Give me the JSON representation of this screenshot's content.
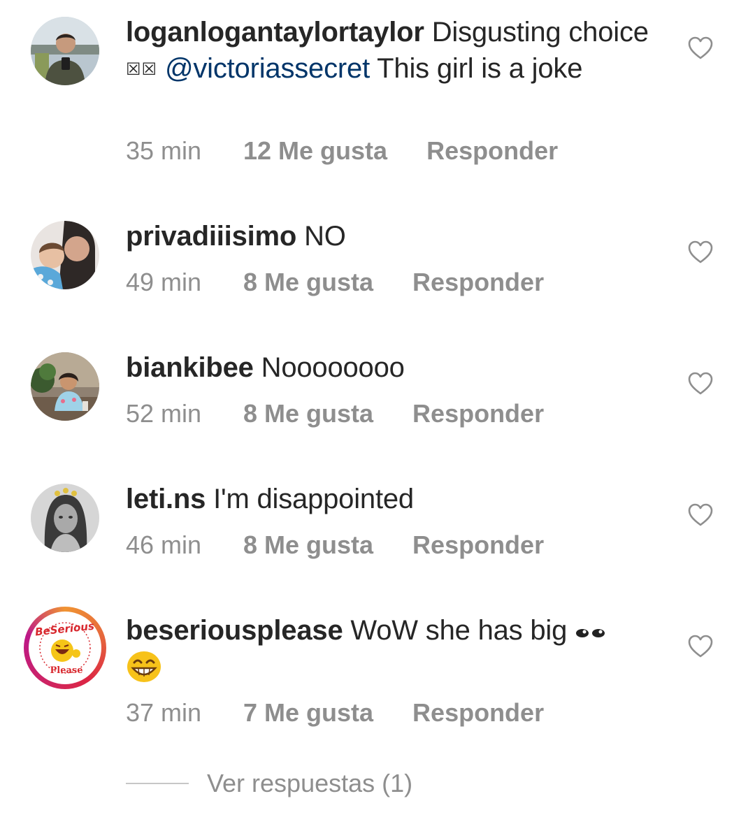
{
  "comments": [
    {
      "username": "loganlogantaylortaylor",
      "text_before": "Disgusting choice ",
      "unknown_glyphs": "☒☒",
      "mention": "@victoriassecret",
      "text_after": " This girl is a joke",
      "time": "35 min",
      "likes": "12 Me gusta",
      "reply": "Responder",
      "avatar_icon": "user-photo-man-icon"
    },
    {
      "username": "privadiiisimo",
      "text": "NO",
      "time": "49 min",
      "likes": "8 Me gusta",
      "reply": "Responder",
      "avatar_icon": "user-photo-two-people-icon"
    },
    {
      "username": "biankibee",
      "text": "Noooooooo",
      "time": "52 min",
      "likes": "8 Me gusta",
      "reply": "Responder",
      "avatar_icon": "user-photo-woman-cafe-icon"
    },
    {
      "username": "leti.ns",
      "text": "I'm disappointed",
      "time": "46 min",
      "likes": "8 Me gusta",
      "reply": "Responder",
      "avatar_icon": "user-photo-girl-bw-icon"
    },
    {
      "username": "beseriousplease",
      "text": "WoW she has big",
      "emoji_1": "eyes-emoji",
      "emoji_2": "grinning-face-emoji",
      "time": "37 min",
      "likes": "7 Me gusta",
      "reply": "Responder",
      "avatar_icon": "beserious-please-logo-icon",
      "avatar_logo_text_top": "BeSerious",
      "avatar_logo_text_bottom": "Please"
    }
  ],
  "view_replies": "Ver respuestas (1)",
  "colors": {
    "text": "#262626",
    "meta": "#8e8e8e",
    "mention": "#003569",
    "heart_stroke": "#8e8e8e",
    "divider": "#c7c7c7"
  }
}
